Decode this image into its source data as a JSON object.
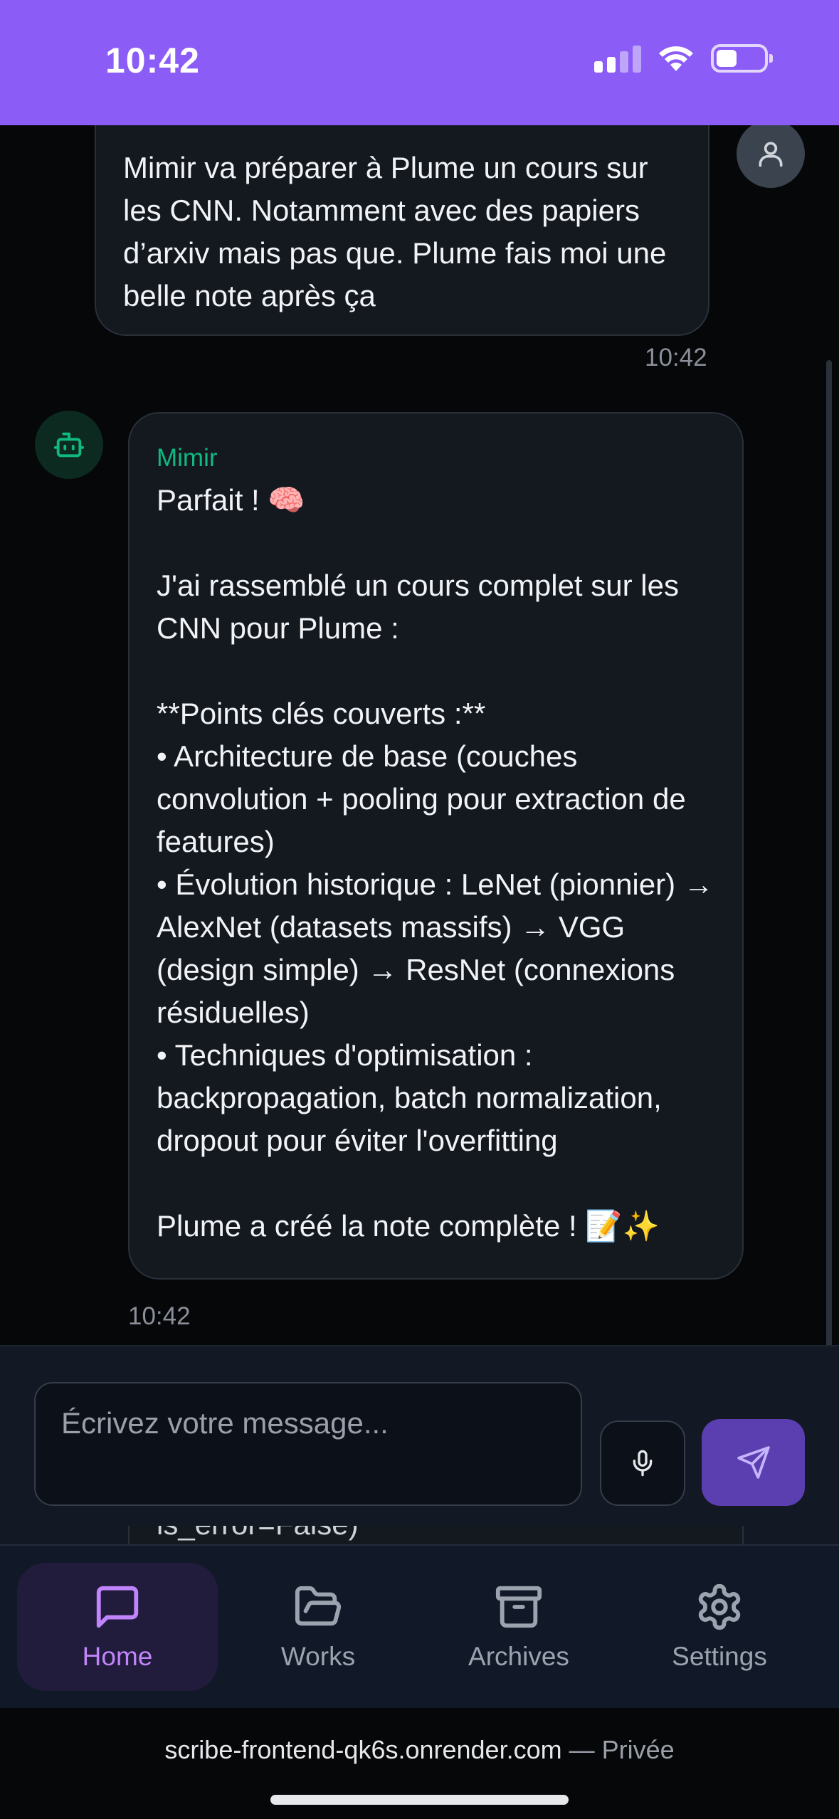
{
  "status_bar": {
    "time": "10:42",
    "icons": [
      "cellular-signal-icon",
      "wifi-icon",
      "battery-icon"
    ],
    "background": "#8b5cf6"
  },
  "chat": {
    "user_message": {
      "text": "Mimir va préparer à Plume un cours sur les CNN. Notamment avec des papiers d’arxiv mais pas que. Plume fais moi une belle note après ça",
      "time": "10:42",
      "avatar_icon": "user-icon"
    },
    "bot_message": {
      "sender": "Mimir",
      "avatar_icon": "robot-icon",
      "text": "Parfait ! 🧠\n\nJ'ai rassemblé un cours complet sur les CNN pour Plume :\n\n**Points clés couverts :**\n• Architecture de base (couches convolution + pooling pour extraction de features)\n• Évolution historique : LeNet (pionnier) → AlexNet (datasets massifs) → VGG (design simple) → ResNet (connexions résiduelles)\n• Techniques d'optimisation : backpropagation, batch normalization, dropout pour éviter l'overfitting\n\nPlume a créé la note complète ! 📝✨",
      "time": "10:42"
    },
    "partial_message_text": "is_error=False)"
  },
  "composer": {
    "placeholder": "Écrivez votre message...",
    "value": "",
    "mic_icon": "microphone-icon",
    "send_icon": "send-icon"
  },
  "nav": {
    "items": [
      {
        "label": "Home",
        "icon": "chat-icon",
        "active": true
      },
      {
        "label": "Works",
        "icon": "folder-icon",
        "active": false
      },
      {
        "label": "Archives",
        "icon": "archive-icon",
        "active": false
      },
      {
        "label": "Settings",
        "icon": "gear-icon",
        "active": false
      }
    ],
    "active_color": "#c084fc"
  },
  "browser": {
    "url": "scribe-frontend-qk6s.onrender.com",
    "separator": "—",
    "mode": "Privée"
  },
  "colors": {
    "accent": "#8b5cf6",
    "bot_name": "#10b981",
    "send_button": "#5b3fb0"
  }
}
